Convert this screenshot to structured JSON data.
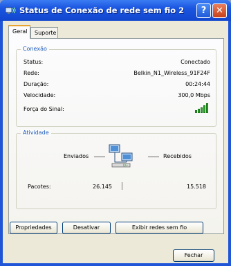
{
  "window": {
    "title": "Status de Conexão de rede sem fio 2",
    "help_button": "?",
    "close_button": "✕"
  },
  "tabs": [
    {
      "label": "Geral",
      "active": true
    },
    {
      "label": "Suporte",
      "active": false
    }
  ],
  "conexao": {
    "label": "Conexão",
    "rows": [
      {
        "label": "Status:",
        "value": "Conectado"
      },
      {
        "label": "Rede:",
        "value": "Belkin_N1_Wireless_91F24F"
      },
      {
        "label": "Duração:",
        "value": "00:24:44"
      },
      {
        "label": "Velocidade:",
        "value": "300,0 Mbps"
      }
    ],
    "signal_label": "Força do Sinal:",
    "signal_bars": 5
  },
  "atividade": {
    "label": "Atividade",
    "sent_label": "Enviados",
    "received_label": "Recebidos",
    "packets_label": "Pacotes:",
    "packets_sent": "26.145",
    "packets_received": "15.518"
  },
  "buttons": {
    "properties": "Propriedades",
    "disable": "Desativar",
    "show_networks": "Exibir redes sem fio",
    "close": "Fechar"
  },
  "colors": {
    "titlebar": "#1a55e0",
    "group_label": "#1d5ab9",
    "signal": "#2fa52f",
    "tab_highlight": "#e6a32f"
  }
}
